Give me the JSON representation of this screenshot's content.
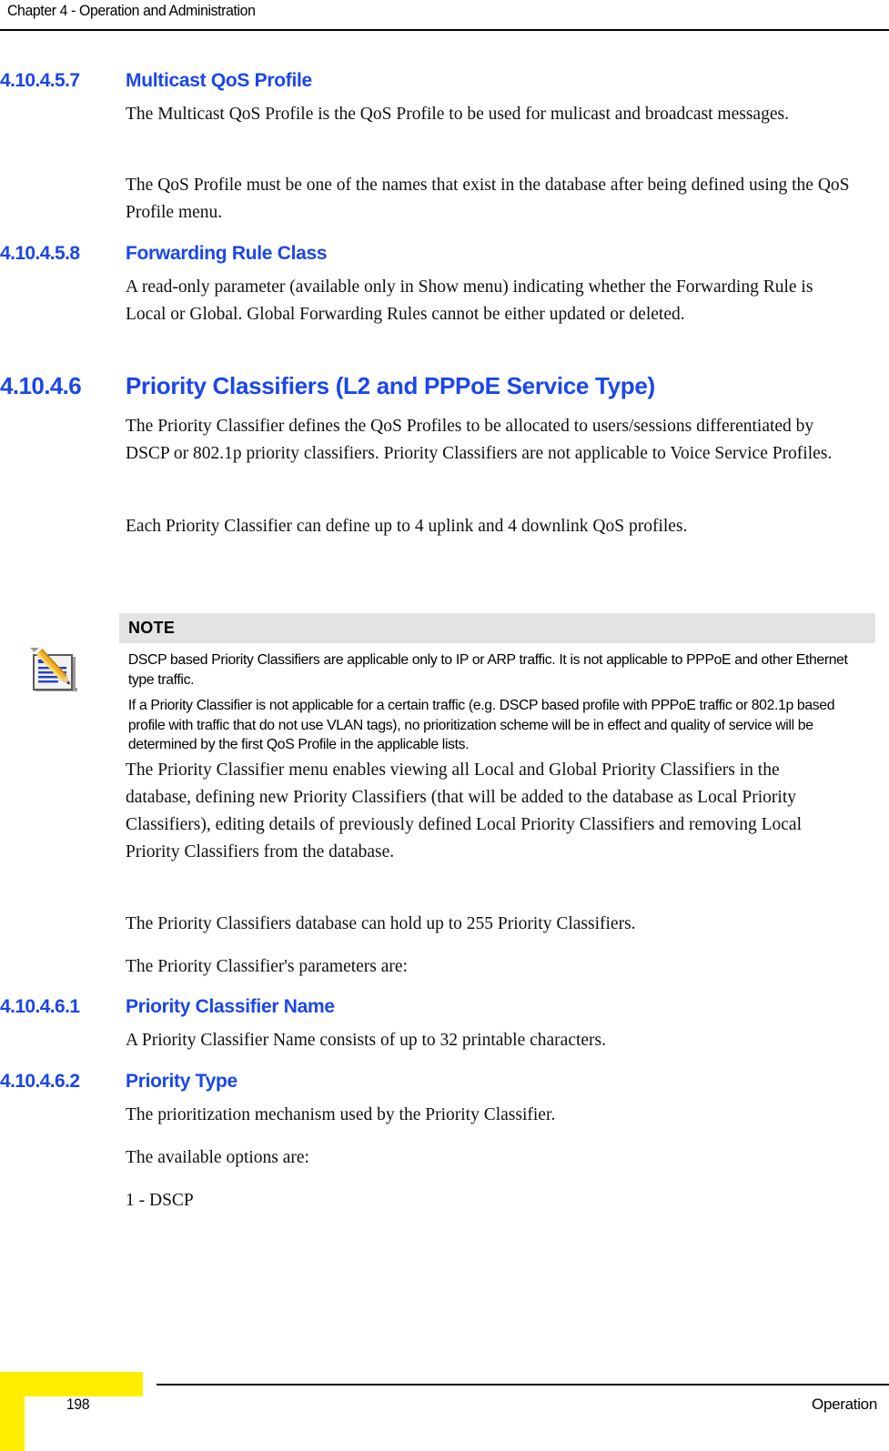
{
  "header": {
    "chapter_title": "Chapter 4 - Operation and Administration"
  },
  "sections": [
    {
      "number": "4.10.4.5.7",
      "title": "Multicast QoS Profile",
      "paragraphs": [
        "The Multicast QoS Profile is the QoS Profile to be used for mulicast and broadcast messages.",
        "The QoS Profile must be one of the names that exist in the database after being defined using the QoS Profile menu."
      ]
    },
    {
      "number": "4.10.4.5.8",
      "title": "Forwarding Rule Class",
      "paragraphs": [
        "A read-only parameter (available only in Show menu) indicating whether the Forwarding Rule is Local or Global. Global Forwarding Rules cannot be either updated or deleted."
      ]
    },
    {
      "number": "4.10.4.6",
      "title": "Priority Classifiers (L2 and PPPoE Service Type)",
      "paragraphs": [
        "The Priority Classifier defines the QoS Profiles to be allocated to users/sessions differentiated by DSCP or 802.1p priority classifiers. Priority Classifiers are not applicable to Voice Service Profiles.",
        "Each Priority Classifier can define up to 4 uplink and 4 downlink QoS profiles."
      ]
    },
    {
      "number": "4.10.4.6.1",
      "title": "Priority Classifier Name",
      "paragraphs": [
        "A Priority Classifier Name consists of up to 32 printable characters."
      ]
    },
    {
      "number": "4.10.4.6.2",
      "title": "Priority Type",
      "paragraphs": [
        "The prioritization mechanism used by the Priority Classifier.",
        "The available options are:",
        "1 - DSCP"
      ]
    }
  ],
  "note": {
    "icon": "notepad-pencil-icon",
    "label": "NOTE",
    "paragraphs": [
      "DSCP based Priority Classifiers are applicable only to IP or ARP traffic. It is not applicable to PPPoE and other Ethernet type traffic.",
      "If a Priority Classifier is not applicable for a certain traffic (e.g. DSCP based profile with PPPoE traffic or 802.1p based profile with traffic that do not use VLAN tags), no prioritization scheme will be in effect and quality of service will be determined by the first QoS Profile in the applicable lists."
    ]
  },
  "after_note_paragraphs": [
    "The Priority Classifier menu enables viewing all Local and Global Priority Classifiers in the database, defining new Priority Classifiers (that will be added to the database as Local Priority Classifiers), editing details of previously defined Local Priority Classifiers and removing Local Priority Classifiers from the database.",
    "The Priority Classifiers database can hold up to 255 Priority Classifiers.",
    "The Priority Classifier's parameters are:"
  ],
  "footer": {
    "page_number": "198",
    "right_label": "Operation",
    "corner_color": "#ffee00"
  },
  "colors": {
    "heading_blue": "#1a46ec",
    "note_bar_gray": "#e3e3e3",
    "footer_yellow": "#ffee00"
  }
}
